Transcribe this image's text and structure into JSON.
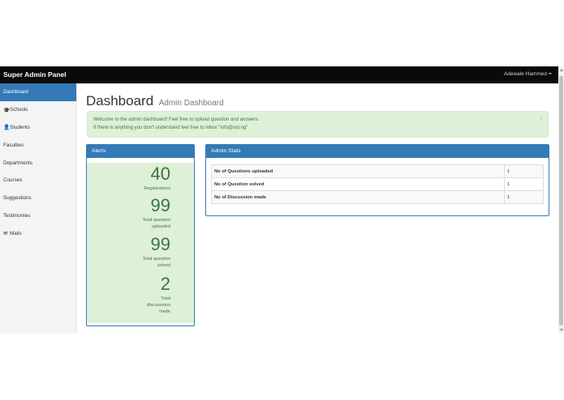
{
  "navbar": {
    "brand": "Super Admin Panel",
    "user": "Adewale Hammed"
  },
  "sidebar": {
    "items": [
      {
        "label": "Dashboard",
        "icon": "",
        "active": true
      },
      {
        "label": "Schools",
        "icon": "graduation-cap-icon"
      },
      {
        "label": "Students",
        "icon": "user-icon"
      },
      {
        "label": "Faculties",
        "icon": ""
      },
      {
        "label": "Departments",
        "icon": ""
      },
      {
        "label": "Courses",
        "icon": ""
      },
      {
        "label": "Suggestions",
        "icon": ""
      },
      {
        "label": "Testimonies",
        "icon": ""
      },
      {
        "label": "Mails",
        "icon": "envelope-icon"
      }
    ]
  },
  "header": {
    "title": "Dashboard",
    "subtitle": "Admin Dashboard"
  },
  "alert": {
    "line1": "Welcome to the admin dashboard! Feel free to upload question and answers.",
    "line2": "If there is anything you don't understand feel free to inbox \"info@sol.ng\".",
    "close": "×"
  },
  "alerts_panel": {
    "title": "Alerts",
    "stats": [
      {
        "value": "40",
        "label": [
          "Registrations"
        ]
      },
      {
        "value": "99",
        "label": [
          "Total question",
          "uploaded"
        ]
      },
      {
        "value": "99",
        "label": [
          "Total question",
          "solved"
        ]
      },
      {
        "value": "2",
        "label": [
          "Total",
          "discussions",
          "made"
        ]
      }
    ]
  },
  "admin_stats": {
    "title": "Admin Stats",
    "rows": [
      {
        "key": "No of Questions uploaded",
        "value": "1"
      },
      {
        "key": "No of Question solved",
        "value": "1"
      },
      {
        "key": "No of Discussion made",
        "value": "1"
      }
    ]
  },
  "colors": {
    "navbar": "#0a0a0a",
    "primary": "#337ab7",
    "success_bg": "#dff0d8",
    "success_text": "#3c763d"
  }
}
